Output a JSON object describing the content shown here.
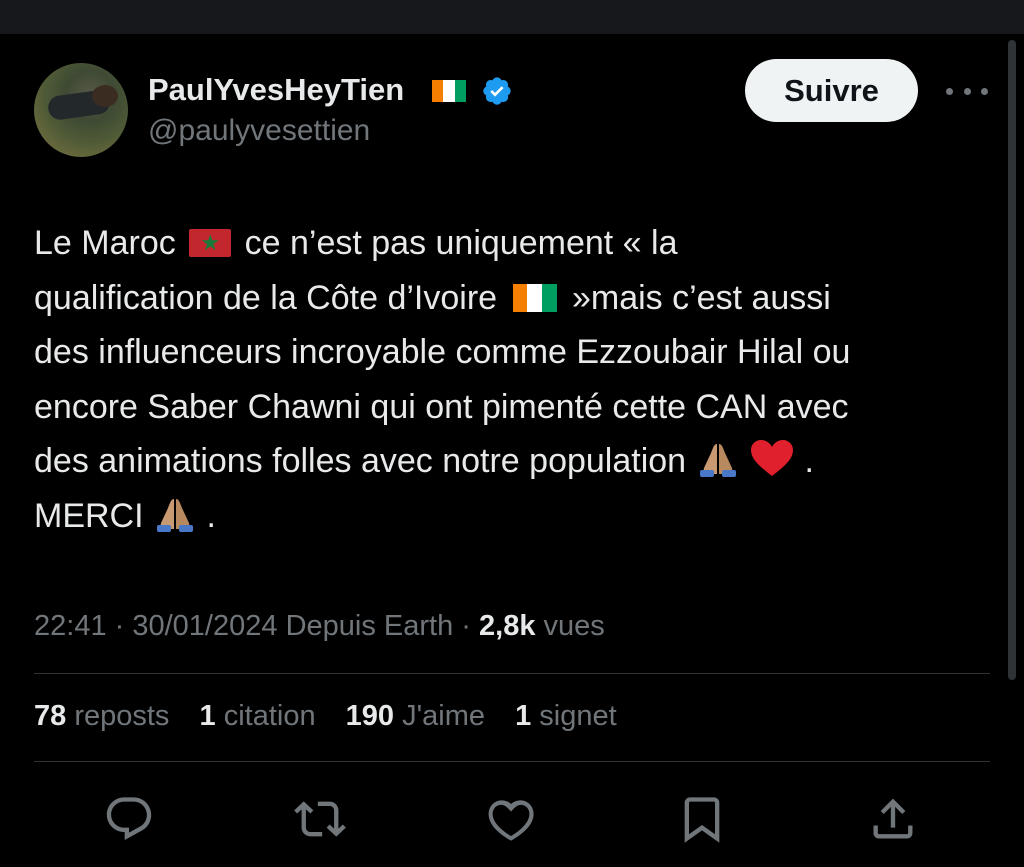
{
  "user": {
    "display_name": "PaulYvesHeyTien",
    "handle": "@paulyvesettien"
  },
  "follow_label": "Suivre",
  "tweet": {
    "line1_a": "Le Maroc",
    "line1_b": "ce n’est pas uniquement « la",
    "line2_a": "qualification de la Côte d’Ivoire",
    "line2_b": "»mais c’est aussi",
    "line3": "des influenceurs incroyable comme Ezzoubair Hilal ou",
    "line4": "encore Saber Chawni qui ont pimenté cette CAN avec",
    "line5_a": "des animations folles avec notre population",
    "line5_b": ".",
    "line6_a": "MERCI",
    "line6_b": "."
  },
  "meta": {
    "time": "22:41",
    "date": "30/01/2024",
    "source": "Depuis Earth",
    "views_count": "2,8k",
    "views_label": "vues"
  },
  "stats": {
    "reposts_count": "78",
    "reposts_label": "reposts",
    "quotes_count": "1",
    "quotes_label": "citation",
    "likes_count": "190",
    "likes_label": "J'aime",
    "bookmarks_count": "1",
    "bookmarks_label": "signet"
  },
  "icons": {
    "verified": "verified-badge-icon",
    "more": "more-icon",
    "reply": "reply-icon",
    "repost": "repost-icon",
    "like": "heart-icon",
    "bookmark": "bookmark-icon",
    "share": "share-icon"
  },
  "colors": {
    "background": "#000000",
    "text": "#e7e9ea",
    "secondary_text": "#71767b",
    "verified_blue": "#1d9bf0",
    "follow_button_bg": "#eff3f4"
  }
}
